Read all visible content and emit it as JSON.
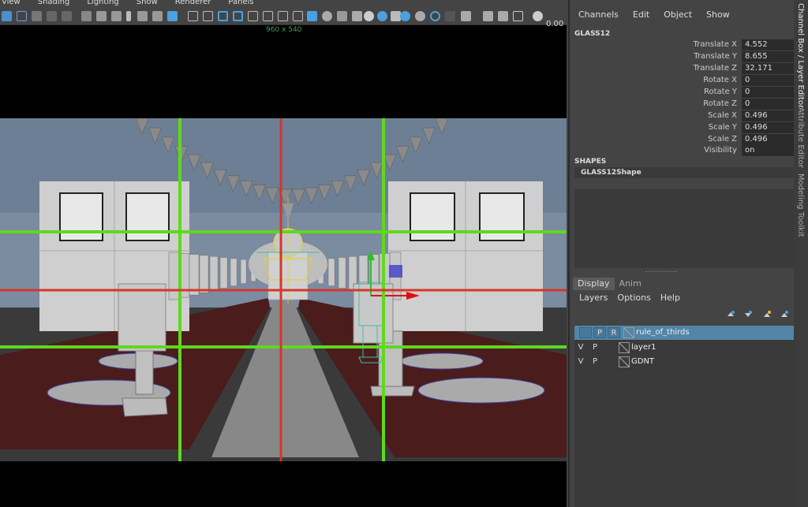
{
  "viewport": {
    "menu": [
      "View",
      "Shading",
      "Lighting",
      "Show",
      "Renderer",
      "Panels"
    ],
    "resolution": "960 x 540",
    "frame_value": "0.00"
  },
  "channel_box": {
    "menu": [
      "Channels",
      "Edit",
      "Object",
      "Show"
    ],
    "object_name": "GLASS12",
    "attributes": [
      {
        "label": "Translate X",
        "value": "4.552"
      },
      {
        "label": "Translate Y",
        "value": "8.655"
      },
      {
        "label": "Translate Z",
        "value": "32.171"
      },
      {
        "label": "Rotate X",
        "value": "0"
      },
      {
        "label": "Rotate Y",
        "value": "0"
      },
      {
        "label": "Rotate Z",
        "value": "0"
      },
      {
        "label": "Scale X",
        "value": "0.496"
      },
      {
        "label": "Scale Y",
        "value": "0.496"
      },
      {
        "label": "Scale Z",
        "value": "0.496"
      },
      {
        "label": "Visibility",
        "value": "on"
      }
    ],
    "shapes_title": "SHAPES",
    "shape_name": "GLASS12Shape"
  },
  "layer_editor": {
    "tabs": [
      "Display",
      "Anim"
    ],
    "menu": [
      "Layers",
      "Options",
      "Help"
    ],
    "layers": [
      {
        "v": "",
        "p": "P",
        "r": "R",
        "name": "rule_of_thirds",
        "selected": true
      },
      {
        "v": "V",
        "p": "P",
        "r": "",
        "name": "layer1",
        "selected": false
      },
      {
        "v": "V",
        "p": "P",
        "r": "",
        "name": "GDNT",
        "selected": false
      }
    ]
  },
  "side_tabs": [
    "Channel Box / Layer Editor",
    "Attribute Editor",
    "Modeling Toolkit"
  ],
  "colors": {
    "grid_green": "#5fd81e",
    "grid_red": "#d3372b",
    "selection_blue": "#5285a6",
    "floor": "#4a1c1c",
    "sky": "#6d7f95"
  }
}
